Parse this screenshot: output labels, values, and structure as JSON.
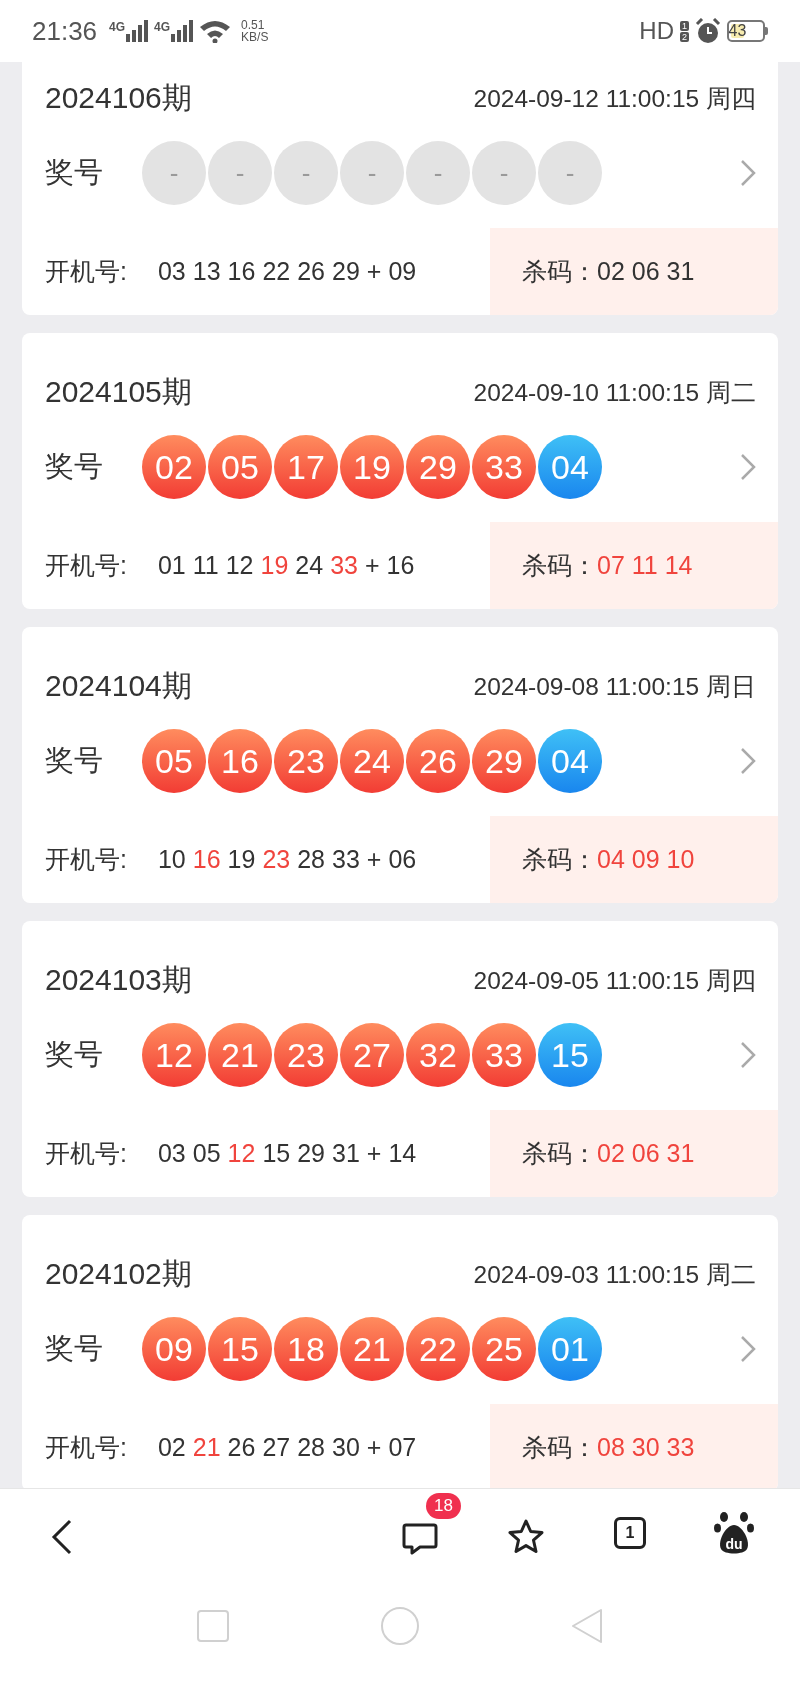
{
  "status_bar": {
    "time": "21:36",
    "signals": [
      "4G",
      "4G"
    ],
    "speed_value": "0.51",
    "speed_unit": "KB/S",
    "hd": "HD",
    "sim_marks": [
      "1",
      "2"
    ],
    "battery": "43"
  },
  "draws": [
    {
      "issue": "2024106期",
      "datetime": "2024-09-12 11:00:15 周四",
      "prize_label": "奖号",
      "balls": [
        {
          "kind": "empty",
          "text": "-"
        },
        {
          "kind": "empty",
          "text": "-"
        },
        {
          "kind": "empty",
          "text": "-"
        },
        {
          "kind": "empty",
          "text": "-"
        },
        {
          "kind": "empty",
          "text": "-"
        },
        {
          "kind": "empty",
          "text": "-"
        },
        {
          "kind": "empty",
          "text": "-"
        }
      ],
      "open_label": "开机号:",
      "open_numbers": [
        {
          "text": "03",
          "hit": false
        },
        {
          "text": "13",
          "hit": false
        },
        {
          "text": "16",
          "hit": false
        },
        {
          "text": "22",
          "hit": false
        },
        {
          "text": "26",
          "hit": false
        },
        {
          "text": "29",
          "hit": false
        }
      ],
      "plus": "+",
      "open_extra": {
        "text": "09",
        "hit": false
      },
      "kill_label": "杀码：",
      "kill_codes": "02 06 31",
      "kill_highlighted": false
    },
    {
      "issue": "2024105期",
      "datetime": "2024-09-10 11:00:15 周二",
      "prize_label": "奖号",
      "balls": [
        {
          "kind": "red",
          "text": "02"
        },
        {
          "kind": "red",
          "text": "05"
        },
        {
          "kind": "red",
          "text": "17"
        },
        {
          "kind": "red",
          "text": "19"
        },
        {
          "kind": "red",
          "text": "29"
        },
        {
          "kind": "red",
          "text": "33"
        },
        {
          "kind": "blue",
          "text": "04"
        }
      ],
      "open_label": "开机号:",
      "open_numbers": [
        {
          "text": "01",
          "hit": false
        },
        {
          "text": "11",
          "hit": false
        },
        {
          "text": "12",
          "hit": false
        },
        {
          "text": "19",
          "hit": true
        },
        {
          "text": "24",
          "hit": false
        },
        {
          "text": "33",
          "hit": true
        }
      ],
      "plus": "+",
      "open_extra": {
        "text": "16",
        "hit": false
      },
      "kill_label": "杀码：",
      "kill_codes": "07 11 14",
      "kill_highlighted": true
    },
    {
      "issue": "2024104期",
      "datetime": "2024-09-08 11:00:15 周日",
      "prize_label": "奖号",
      "balls": [
        {
          "kind": "red",
          "text": "05"
        },
        {
          "kind": "red",
          "text": "16"
        },
        {
          "kind": "red",
          "text": "23"
        },
        {
          "kind": "red",
          "text": "24"
        },
        {
          "kind": "red",
          "text": "26"
        },
        {
          "kind": "red",
          "text": "29"
        },
        {
          "kind": "blue",
          "text": "04"
        }
      ],
      "open_label": "开机号:",
      "open_numbers": [
        {
          "text": "10",
          "hit": false
        },
        {
          "text": "16",
          "hit": true
        },
        {
          "text": "19",
          "hit": false
        },
        {
          "text": "23",
          "hit": true
        },
        {
          "text": "28",
          "hit": false
        },
        {
          "text": "33",
          "hit": false
        }
      ],
      "plus": "+",
      "open_extra": {
        "text": "06",
        "hit": false
      },
      "kill_label": "杀码：",
      "kill_codes": "04 09 10",
      "kill_highlighted": true
    },
    {
      "issue": "2024103期",
      "datetime": "2024-09-05 11:00:15 周四",
      "prize_label": "奖号",
      "balls": [
        {
          "kind": "red",
          "text": "12"
        },
        {
          "kind": "red",
          "text": "21"
        },
        {
          "kind": "red",
          "text": "23"
        },
        {
          "kind": "red",
          "text": "27"
        },
        {
          "kind": "red",
          "text": "32"
        },
        {
          "kind": "red",
          "text": "33"
        },
        {
          "kind": "blue",
          "text": "15"
        }
      ],
      "open_label": "开机号:",
      "open_numbers": [
        {
          "text": "03",
          "hit": false
        },
        {
          "text": "05",
          "hit": false
        },
        {
          "text": "12",
          "hit": true
        },
        {
          "text": "15",
          "hit": false
        },
        {
          "text": "29",
          "hit": false
        },
        {
          "text": "31",
          "hit": false
        }
      ],
      "plus": "+",
      "open_extra": {
        "text": "14",
        "hit": false
      },
      "kill_label": "杀码：",
      "kill_codes": "02 06 31",
      "kill_highlighted": true
    },
    {
      "issue": "2024102期",
      "datetime": "2024-09-03 11:00:15 周二",
      "prize_label": "奖号",
      "balls": [
        {
          "kind": "red",
          "text": "09"
        },
        {
          "kind": "red",
          "text": "15"
        },
        {
          "kind": "red",
          "text": "18"
        },
        {
          "kind": "red",
          "text": "21"
        },
        {
          "kind": "red",
          "text": "22"
        },
        {
          "kind": "red",
          "text": "25"
        },
        {
          "kind": "blue",
          "text": "01"
        }
      ],
      "open_label": "开机号:",
      "open_numbers": [
        {
          "text": "02",
          "hit": false
        },
        {
          "text": "21",
          "hit": true
        },
        {
          "text": "26",
          "hit": false
        },
        {
          "text": "27",
          "hit": false
        },
        {
          "text": "28",
          "hit": false
        },
        {
          "text": "30",
          "hit": false
        }
      ],
      "plus": "+",
      "open_extra": {
        "text": "07",
        "hit": false
      },
      "kill_label": "杀码：",
      "kill_codes": "08 30 33",
      "kill_highlighted": true
    }
  ],
  "toolbar": {
    "comment_badge": "18",
    "tab_count": "1",
    "logo_text": "du"
  }
}
